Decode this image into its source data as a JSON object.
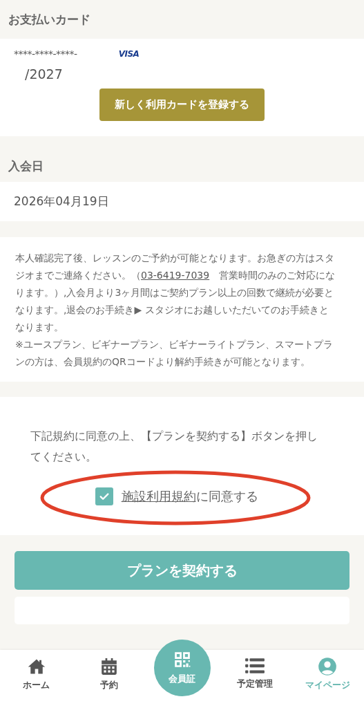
{
  "payment_card": {
    "heading": "お支払いカード",
    "card_number": "****-****-****-",
    "brand": "VISA",
    "expiry": "/2027",
    "register_button": "新しく利用カードを登録する"
  },
  "join_date": {
    "heading": "入会日",
    "value": "2026年04月19日"
  },
  "notice": {
    "text_before": "本人確認完了後、レッスンのご予約が可能となります。お急ぎの方はスタジオまでご連絡ください。（",
    "phone": "03-6419-7039",
    "text_after": "　営業時間のみのご対応になります。）,入会月より3ヶ月間はご契約プラン以上の回数で継続が必要となります。,退会のお手続き▶ スタジオにお越しいただいてのお手続きとなります。",
    "note": "※ユースプラン、ビギナープラン、ビギナーライトプラン、スマートプランの方は、会員規約のQRコードより解約手続きが可能となります。"
  },
  "agreement": {
    "intro": "下記規約に同意の上、【プランを契約する】ボタンを押してください。",
    "checked": true,
    "terms_link": "施設利用規約",
    "terms_rest": "に同意する",
    "highlighted": true
  },
  "contract_button": "プランを契約する",
  "bottom_nav": [
    {
      "kind": "home",
      "label": "ホーム",
      "selected": false
    },
    {
      "kind": "calendar",
      "label": "予約",
      "selected": false
    },
    {
      "kind": "qr",
      "label": "会員証",
      "selected": false
    },
    {
      "kind": "list",
      "label": "予定管理",
      "selected": false
    },
    {
      "kind": "person",
      "label": "マイページ",
      "selected": true
    }
  ]
}
